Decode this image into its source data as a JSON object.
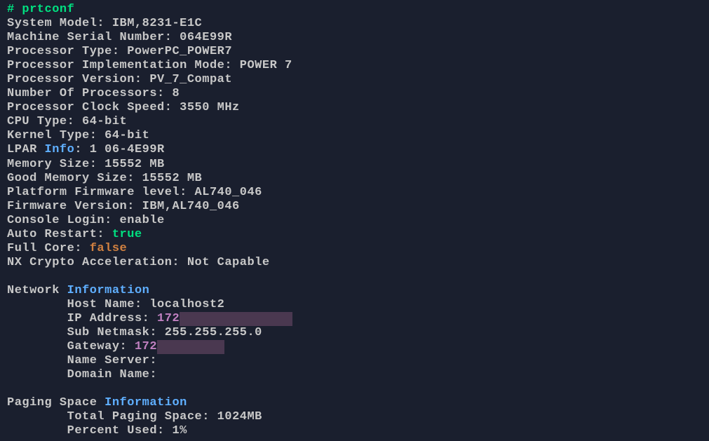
{
  "prompt": "# ",
  "command": "prtconf",
  "sys": {
    "model_label": "System Model: ",
    "model": "IBM,8231-E1C",
    "serial_label": "Machine Serial Number: ",
    "serial": "064E99R",
    "ptype_label": "Processor Type: ",
    "ptype": "PowerPC_POWER7",
    "pimpl_label": "Processor Implementation Mode: ",
    "pimpl": "POWER 7",
    "pver_label": "Processor Version: ",
    "pver": "PV_7_Compat",
    "nproc_label": "Number Of Processors: ",
    "nproc": "8",
    "pclock_label": "Processor Clock Speed: ",
    "pclock": "3550 MHz",
    "cputype_label": "CPU Type: ",
    "cputype": "64-bit",
    "kerntype_label": "Kernel Type: ",
    "kerntype": "64-bit",
    "lpar_prefix": "LPAR ",
    "lpar_info_word": "Info",
    "lpar_suffix": ": ",
    "lpar": "1 06-4E99R",
    "mem_label": "Memory Size: ",
    "mem": "15552 MB",
    "goodmem_label": "Good Memory Size: ",
    "goodmem": "15552 MB",
    "fwlevel_label": "Platform Firmware level: ",
    "fwlevel": "AL740_046",
    "fwver_label": "Firmware Version: ",
    "fwver": "IBM,AL740_046",
    "console_label": "Console Login: ",
    "console": "enable",
    "autorestart_label": "Auto Restart: ",
    "autorestart": "true",
    "fullcore_label": "Full Core: ",
    "fullcore": "false",
    "nxcrypto_label": "NX Crypto Acceleration: ",
    "nxcrypto": "Not Capable"
  },
  "net": {
    "header_prefix": "Network ",
    "header_info": "Information",
    "indent": "        ",
    "host_label": "Host Name: ",
    "host": "localhost2",
    "ip_label": "IP Address: ",
    "ip_partial": "172",
    "ip_redacted": "               ",
    "mask_label": "Sub Netmask: ",
    "mask": "255.255.255.0",
    "gw_label": "Gateway: ",
    "gw_partial": "172",
    "gw_redacted": "         ",
    "ns_label": "Name Server:",
    "domain_label": "Domain Name:"
  },
  "paging": {
    "header_prefix": "Paging Space ",
    "header_info": "Information",
    "indent": "        ",
    "total_label": "Total Paging Space: ",
    "total": "1024MB",
    "pct_label": "Percent Used: ",
    "pct": "1%"
  }
}
